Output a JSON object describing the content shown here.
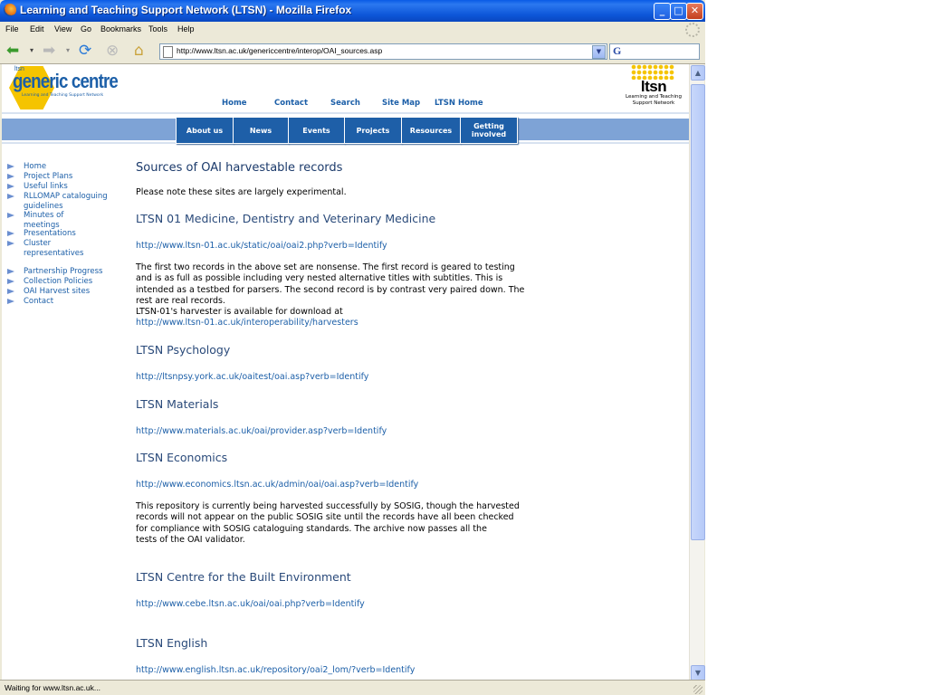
{
  "window": {
    "title": "Learning and Teaching Support Network (LTSN) - Mozilla Firefox"
  },
  "menu": [
    "File",
    "Edit",
    "View",
    "Go",
    "Bookmarks",
    "Tools",
    "Help"
  ],
  "address": {
    "url": "http://www.ltsn.ac.uk/genericcentre/interop/OAI_sources.asp"
  },
  "header": {
    "logo_small": "ltsn",
    "logo_main": "generic centre",
    "logo_sub": "Learning and Teaching Support Network",
    "topnav": [
      "Home",
      "Contact",
      "Search",
      "Site Map",
      "LTSN Home"
    ],
    "ltsn_word": "ltsn",
    "ltsn_tag": "Learning and Teaching Support Network",
    "tabs": [
      "About us",
      "News",
      "Events",
      "Projects",
      "Resources",
      "Getting involved"
    ]
  },
  "leftnav": {
    "group1": [
      "Home",
      "Project Plans",
      "Useful links",
      "RLLOMAP cataloguing guidelines",
      "Minutes of meetings",
      "Presentations",
      "Cluster representatives"
    ],
    "group2": [
      "Partnership Progress",
      "Collection Policies",
      "OAI Harvest sites",
      "Contact"
    ]
  },
  "main": {
    "title": "Sources of OAI harvestable records",
    "intro": "Please note these sites are largely experimental.",
    "sections": [
      {
        "heading": "LTSN 01 Medicine, Dentistry and Veterinary Medicine",
        "link": "http://www.ltsn-01.ac.uk/static/oai/oai2.php?verb=Identify",
        "text": "The first two records in the above set are nonsense. The first record is geared to testing and is as full as possible including very nested alternative titles with subtitles. This is intended as a testbed for parsers. The second record is by contrast very paired down. The rest are real records.",
        "text2": "LTSN-01's harvester is available for download at",
        "link2": "http://www.ltsn-01.ac.uk/interoperability/harvesters"
      },
      {
        "heading": "LTSN Psychology",
        "link": "http://ltsnpsy.york.ac.uk/oaitest/oai.asp?verb=Identify"
      },
      {
        "heading": "LTSN Materials",
        "link": "http://www.materials.ac.uk/oai/provider.asp?verb=Identify"
      },
      {
        "heading": "LTSN Economics",
        "link": "http://www.economics.ltsn.ac.uk/admin/oai/oai.asp?verb=Identify",
        "text": "This repository is currently being harvested successfully by SOSIG, though the harvested records will not appear on the public SOSIG site until the records have all been checked for compliance with SOSIG cataloguing standards. The archive now passes all the",
        "text2": "tests of the OAI validator."
      },
      {
        "heading": "LTSN Centre for the Built Environment",
        "link": "http://www.cebe.ltsn.ac.uk/oai/oai.php?verb=Identify"
      },
      {
        "heading": "LTSN English",
        "link": "http://www.english.ltsn.ac.uk/repository/oai2_lom/?verb=Identify"
      }
    ]
  },
  "status": {
    "text": "Waiting for www.ltsn.ac.uk..."
  }
}
